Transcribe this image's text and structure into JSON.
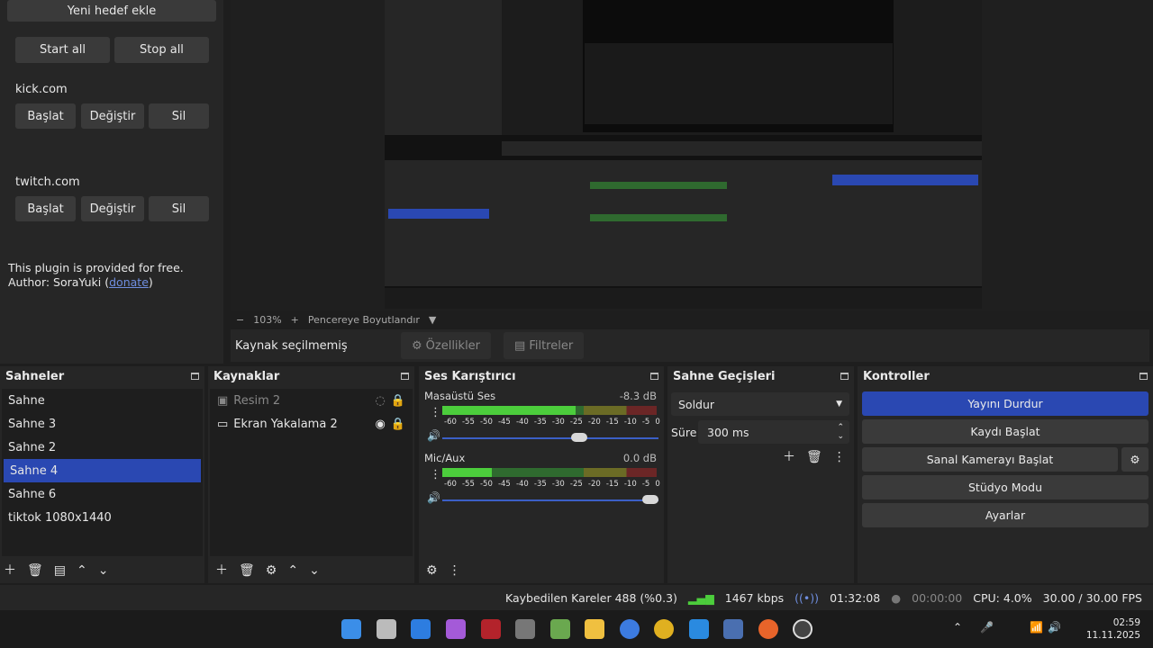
{
  "plugin": {
    "add_target": "Yeni hedef ekle",
    "start_all": "Start all",
    "stop_all": "Stop all",
    "targets": [
      {
        "name": "kick.com",
        "start": "Başlat",
        "edit": "Değiştir",
        "delete": "Sil"
      },
      {
        "name": "twitch.com",
        "start": "Başlat",
        "edit": "Değiştir",
        "delete": "Sil"
      }
    ],
    "info_line1": "This plugin is provided for free.",
    "info_author_prefix": "Author: SoraYuki (",
    "donate": "donate",
    "info_author_suffix": ")"
  },
  "zoom": {
    "minus": "−",
    "value": "103%",
    "plus": "+",
    "fit": "Pencereye Boyutlandır"
  },
  "source_bar": {
    "status": "Kaynak seçilmemiş",
    "properties": "Özellikler",
    "filters": "Filtreler"
  },
  "scenes": {
    "title": "Sahneler",
    "items": [
      "Sahne",
      "Sahne 3",
      "Sahne 2",
      "Sahne 4",
      "Sahne 6",
      "tiktok 1080x1440"
    ],
    "active_index": 3
  },
  "sources": {
    "title": "Kaynaklar",
    "items": [
      {
        "name": "Resim 2",
        "visible": false
      },
      {
        "name": "Ekran Yakalama 2",
        "visible": true
      }
    ]
  },
  "mixer": {
    "title": "Ses Karıştırıcı",
    "channels": [
      {
        "name": "Masaüstü Ses",
        "db": "-8.3 dB",
        "level": 0.62,
        "volume": 0.67
      },
      {
        "name": "Mic/Aux",
        "db": "0.0 dB",
        "level": 0.23,
        "volume": 1.0
      }
    ],
    "scale": [
      "-60",
      "-55",
      "-50",
      "-45",
      "-40",
      "-35",
      "-30",
      "-25",
      "-20",
      "-15",
      "-10",
      "-5",
      "0"
    ]
  },
  "transitions": {
    "title": "Sahne Geçişleri",
    "selected": "Soldur",
    "duration_label": "Süre",
    "duration_value": "300 ms"
  },
  "controls": {
    "title": "Kontroller",
    "stop_stream": "Yayını Durdur",
    "start_record": "Kaydı Başlat",
    "start_vcam": "Sanal Kamerayı Başlat",
    "studio_mode": "Stüdyo Modu",
    "settings": "Ayarlar"
  },
  "status": {
    "dropped": "Kaybedilen Kareler 488 (%0.3)",
    "bitrate": "1467 kbps",
    "stream_time": "01:32:08",
    "record_time": "00:00:00",
    "cpu": "CPU: 4.0%",
    "fps": "30.00 / 30.00 FPS"
  },
  "taskbar": {
    "time": "02:59",
    "date": "11.11.2025"
  },
  "colors": {
    "accent": "#2a48b2",
    "meter_green": "#4ccd3c",
    "link": "#6f8ee0"
  }
}
